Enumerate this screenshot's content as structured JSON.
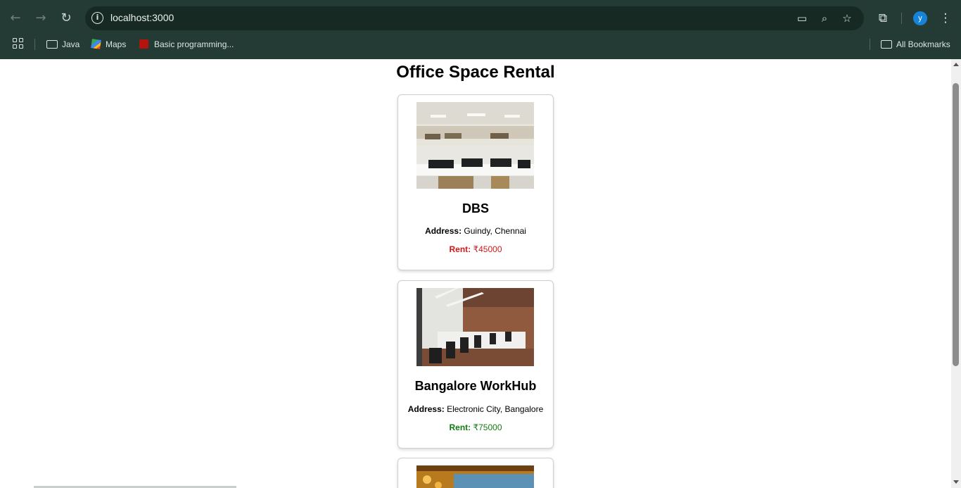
{
  "browser": {
    "url": "localhost:3000",
    "profile_initial": "y",
    "bookmarks": [
      "Java",
      "Maps",
      "Basic programming..."
    ],
    "all_bookmarks_label": "All Bookmarks",
    "icons": [
      "back-arrow-icon",
      "forward-arrow-icon",
      "reload-icon",
      "info-icon",
      "install-app-icon",
      "zoom-out-icon",
      "star-icon",
      "extensions-icon",
      "more-icon",
      "apps-icon",
      "folder-icon",
      "maps-icon"
    ],
    "colors": {
      "frame": "#233b34",
      "omnibox": "#162923",
      "avatar": "#1683d8"
    }
  },
  "page": {
    "title": "Office Space Rental",
    "listings": [
      {
        "name": "DBS",
        "address_label": "Address:",
        "address": "Guindy, Chennai",
        "rent_label": "Rent:",
        "rent": "₹45000",
        "rent_color": "#d01818"
      },
      {
        "name": "Bangalore WorkHub",
        "address_label": "Address:",
        "address": "Electronic City, Bangalore",
        "rent_label": "Rent:",
        "rent": "₹75000",
        "rent_color": "#127a12"
      }
    ]
  }
}
